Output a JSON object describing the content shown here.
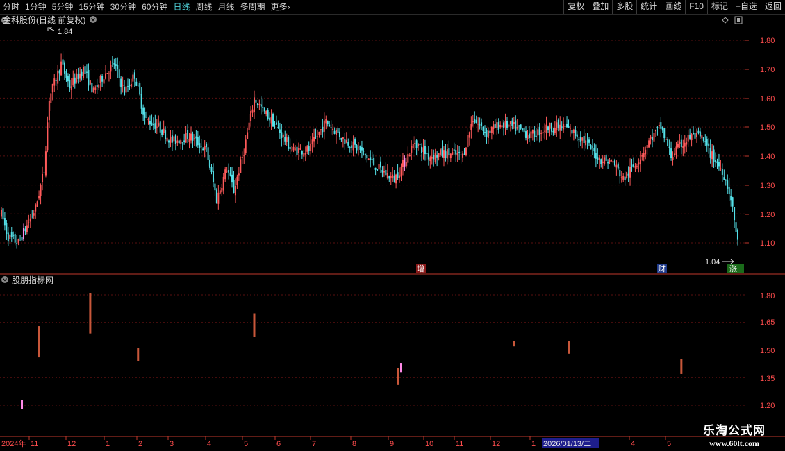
{
  "toolbar": {
    "tabs": [
      "分时",
      "1分钟",
      "5分钟",
      "15分钟",
      "30分钟",
      "60分钟",
      "日线",
      "周线",
      "月线",
      "多周期",
      "更多"
    ],
    "active_tab": "日线",
    "more_arrow": "›",
    "right_buttons": [
      "复权",
      "叠加",
      "多股",
      "统计",
      "画线",
      "F10",
      "标记",
      "+自选",
      "返回"
    ]
  },
  "main": {
    "title": "金科股份(日线 前复权)",
    "high_label": "1.84",
    "low_label": "1.04",
    "marker_zeng": "增",
    "marker_cai": "财",
    "marker_zhangting": "涨",
    "y_ticks": [
      "1.80",
      "1.70",
      "1.60",
      "1.50",
      "1.40",
      "1.30",
      "1.20",
      "1.10"
    ]
  },
  "indicator": {
    "title": "股朋指标网",
    "y_ticks": [
      "1.80",
      "1.65",
      "1.50",
      "1.35",
      "1.20"
    ]
  },
  "x_axis": {
    "labels": [
      "2024年",
      "11",
      "12",
      "1",
      "2",
      "3",
      "4",
      "5",
      "6",
      "7",
      "8",
      "9",
      "10",
      "11",
      "12",
      "1",
      "2026/01/13/二",
      "4",
      "5"
    ]
  },
  "watermark": {
    "line1": "乐淘公式网",
    "line2": "www.60lt.com"
  },
  "colors": {
    "up": "#ff5a5a",
    "down": "#54e0e8",
    "flat": "#e0e0e0",
    "pink": "#ff8ae8",
    "signal": "#c8573a",
    "axis": "#c0392b",
    "grid": "#5a1010"
  },
  "chart_data": {
    "type": "candlestick",
    "title": "金科股份(日线 前复权)",
    "price_range": [
      1.04,
      1.84
    ],
    "ylim": [
      1.05,
      1.87
    ],
    "anchors": [
      {
        "x": 0,
        "v": 1.2
      },
      {
        "x": 4,
        "v": 1.12
      },
      {
        "x": 10,
        "v": 1.1
      },
      {
        "x": 15,
        "v": 1.16
      },
      {
        "x": 20,
        "v": 1.22
      },
      {
        "x": 25,
        "v": 1.35
      },
      {
        "x": 28,
        "v": 1.6
      },
      {
        "x": 35,
        "v": 1.72
      },
      {
        "x": 40,
        "v": 1.64
      },
      {
        "x": 48,
        "v": 1.7
      },
      {
        "x": 54,
        "v": 1.62
      },
      {
        "x": 60,
        "v": 1.68
      },
      {
        "x": 66,
        "v": 1.72
      },
      {
        "x": 72,
        "v": 1.62
      },
      {
        "x": 78,
        "v": 1.68
      },
      {
        "x": 84,
        "v": 1.53
      },
      {
        "x": 92,
        "v": 1.5
      },
      {
        "x": 100,
        "v": 1.45
      },
      {
        "x": 110,
        "v": 1.47
      },
      {
        "x": 120,
        "v": 1.42
      },
      {
        "x": 126,
        "v": 1.25
      },
      {
        "x": 132,
        "v": 1.36
      },
      {
        "x": 136,
        "v": 1.28
      },
      {
        "x": 142,
        "v": 1.42
      },
      {
        "x": 148,
        "v": 1.6
      },
      {
        "x": 154,
        "v": 1.55
      },
      {
        "x": 160,
        "v": 1.51
      },
      {
        "x": 170,
        "v": 1.42
      },
      {
        "x": 180,
        "v": 1.42
      },
      {
        "x": 190,
        "v": 1.52
      },
      {
        "x": 200,
        "v": 1.46
      },
      {
        "x": 210,
        "v": 1.42
      },
      {
        "x": 220,
        "v": 1.36
      },
      {
        "x": 230,
        "v": 1.32
      },
      {
        "x": 236,
        "v": 1.38
      },
      {
        "x": 242,
        "v": 1.45
      },
      {
        "x": 250,
        "v": 1.4
      },
      {
        "x": 260,
        "v": 1.41
      },
      {
        "x": 270,
        "v": 1.4
      },
      {
        "x": 276,
        "v": 1.53
      },
      {
        "x": 284,
        "v": 1.48
      },
      {
        "x": 292,
        "v": 1.51
      },
      {
        "x": 300,
        "v": 1.5
      },
      {
        "x": 310,
        "v": 1.47
      },
      {
        "x": 320,
        "v": 1.5
      },
      {
        "x": 330,
        "v": 1.5
      },
      {
        "x": 340,
        "v": 1.46
      },
      {
        "x": 350,
        "v": 1.39
      },
      {
        "x": 358,
        "v": 1.38
      },
      {
        "x": 364,
        "v": 1.32
      },
      {
        "x": 372,
        "v": 1.38
      },
      {
        "x": 380,
        "v": 1.46
      },
      {
        "x": 386,
        "v": 1.5
      },
      {
        "x": 392,
        "v": 1.4
      },
      {
        "x": 398,
        "v": 1.44
      },
      {
        "x": 404,
        "v": 1.47
      },
      {
        "x": 410,
        "v": 1.46
      },
      {
        "x": 416,
        "v": 1.4
      },
      {
        "x": 422,
        "v": 1.35
      },
      {
        "x": 426,
        "v": 1.28
      },
      {
        "x": 429,
        "v": 1.18
      },
      {
        "x": 431,
        "v": 1.1
      }
    ],
    "n_bars": 432,
    "highlighted_bars": [
      13,
      236
    ],
    "indicator_signals": [
      {
        "x": 12,
        "from": 1.18,
        "to": 1.23,
        "color": "pink"
      },
      {
        "x": 22,
        "from": 1.46,
        "to": 1.63,
        "color": "signal"
      },
      {
        "x": 52,
        "from": 1.59,
        "to": 1.81,
        "color": "signal"
      },
      {
        "x": 80,
        "from": 1.44,
        "to": 1.51,
        "color": "signal"
      },
      {
        "x": 148,
        "from": 1.57,
        "to": 1.7,
        "color": "signal"
      },
      {
        "x": 232,
        "from": 1.31,
        "to": 1.4,
        "color": "signal"
      },
      {
        "x": 234,
        "from": 1.38,
        "to": 1.43,
        "color": "pink"
      },
      {
        "x": 300,
        "from": 1.52,
        "to": 1.55,
        "color": "signal"
      },
      {
        "x": 332,
        "from": 1.48,
        "to": 1.55,
        "color": "signal"
      },
      {
        "x": 398,
        "from": 1.37,
        "to": 1.45,
        "color": "signal"
      }
    ],
    "indicator_ylim": [
      1.13,
      1.88
    ]
  }
}
